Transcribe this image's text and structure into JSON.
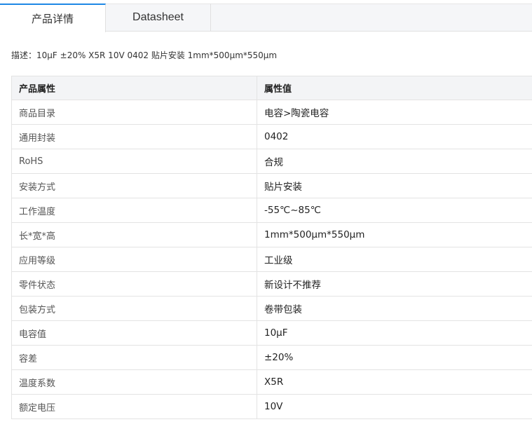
{
  "tabs": {
    "active_label": "产品详情",
    "datasheet_label": "Datasheet"
  },
  "description": {
    "label": "描述：",
    "text": "10μF ±20% X5R 10V 0402 贴片安装 1mm*500μm*550μm"
  },
  "table": {
    "headers": [
      "产品属性",
      "属性值"
    ],
    "rows": [
      {
        "name": "商品目录",
        "value": "电容>陶瓷电容"
      },
      {
        "name": "通用封装",
        "value": "0402"
      },
      {
        "name": "RoHS",
        "value": "合规"
      },
      {
        "name": "安装方式",
        "value": "贴片安装"
      },
      {
        "name": "工作温度",
        "value": "-55℃~85℃"
      },
      {
        "name": "长*宽*高",
        "value": "1mm*500μm*550μm"
      },
      {
        "name": "应用等级",
        "value": "工业级"
      },
      {
        "name": "零件状态",
        "value": "新设计不推荐"
      },
      {
        "name": "包装方式",
        "value": "卷带包装"
      },
      {
        "name": "电容值",
        "value": "10μF"
      },
      {
        "name": "容差",
        "value": "±20%"
      },
      {
        "name": "温度系数",
        "value": "X5R"
      },
      {
        "name": "额定电压",
        "value": "10V"
      }
    ]
  }
}
